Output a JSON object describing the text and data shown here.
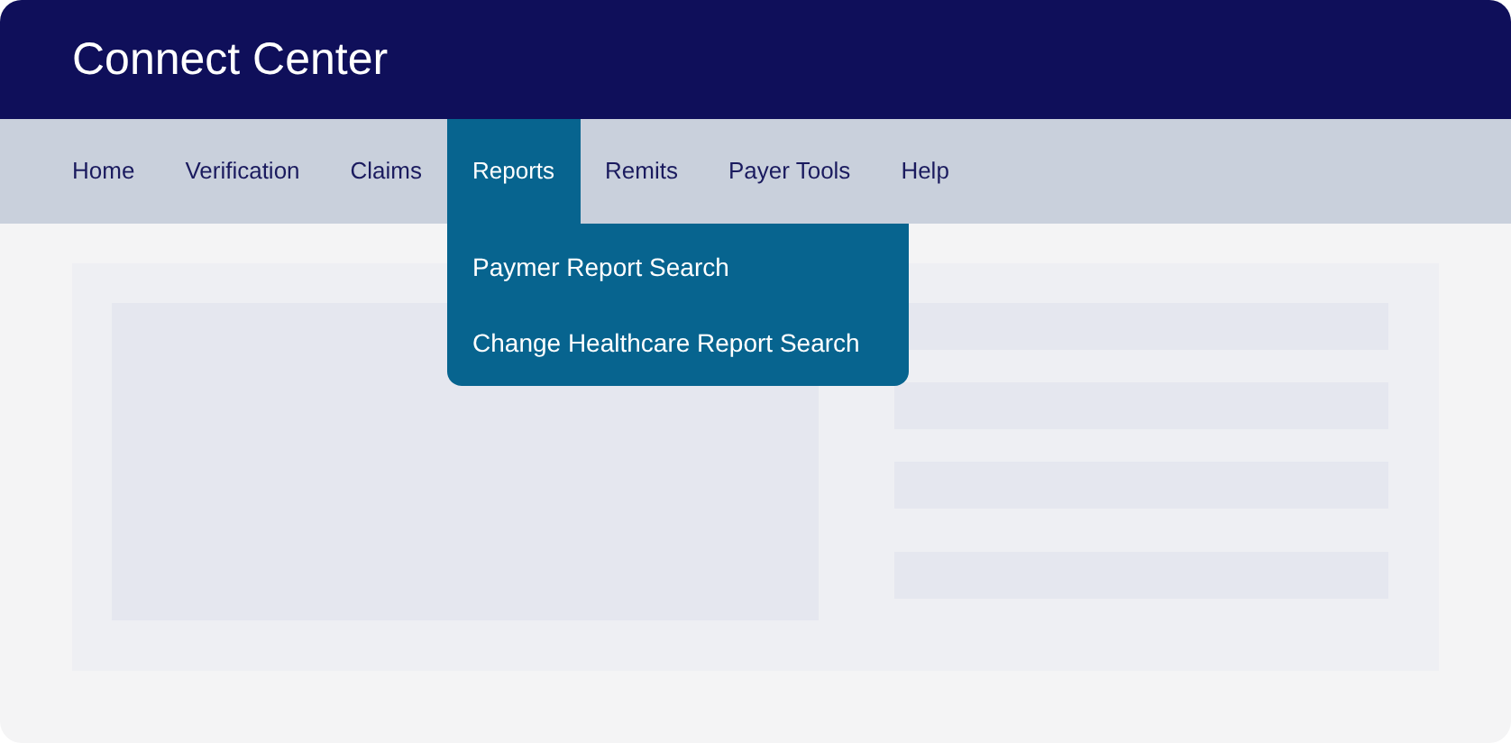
{
  "header": {
    "title": "Connect Center"
  },
  "nav": {
    "items": [
      {
        "label": "Home",
        "selected": false
      },
      {
        "label": "Verification",
        "selected": false
      },
      {
        "label": "Claims",
        "selected": false
      },
      {
        "label": "Reports",
        "selected": true,
        "menu": [
          "Paymer Report Search",
          "Change Healthcare Report Search"
        ]
      },
      {
        "label": "Remits",
        "selected": false
      },
      {
        "label": "Payer Tools",
        "selected": false
      },
      {
        "label": "Help",
        "selected": false
      }
    ]
  }
}
